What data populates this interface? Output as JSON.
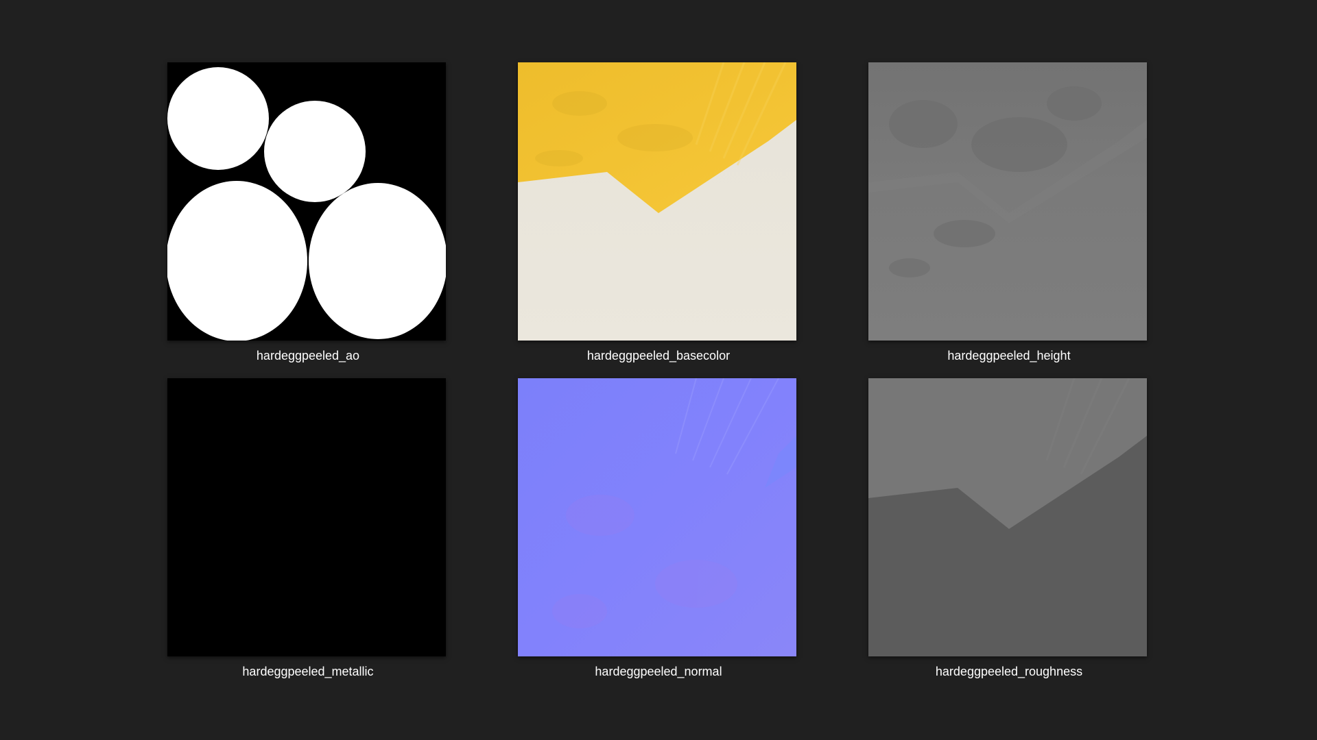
{
  "files": [
    {
      "name": "hardeggpeeled_ao"
    },
    {
      "name": "hardeggpeeled_basecolor"
    },
    {
      "name": "hardeggpeeled_height"
    },
    {
      "name": "hardeggpeeled_metallic"
    },
    {
      "name": "hardeggpeeled_normal"
    },
    {
      "name": "hardeggpeeled_roughness"
    }
  ],
  "colors": {
    "background": "#202020",
    "ao_white": "#ffffff",
    "ao_black": "#000000",
    "yolk": "#f0c030",
    "egg_white": "#e6e2d8",
    "height_gray": "#7a7a7a",
    "normal_blue": "#8080fc",
    "roughness_light": "#7a7a7a",
    "roughness_dark": "#5c5c5c"
  }
}
